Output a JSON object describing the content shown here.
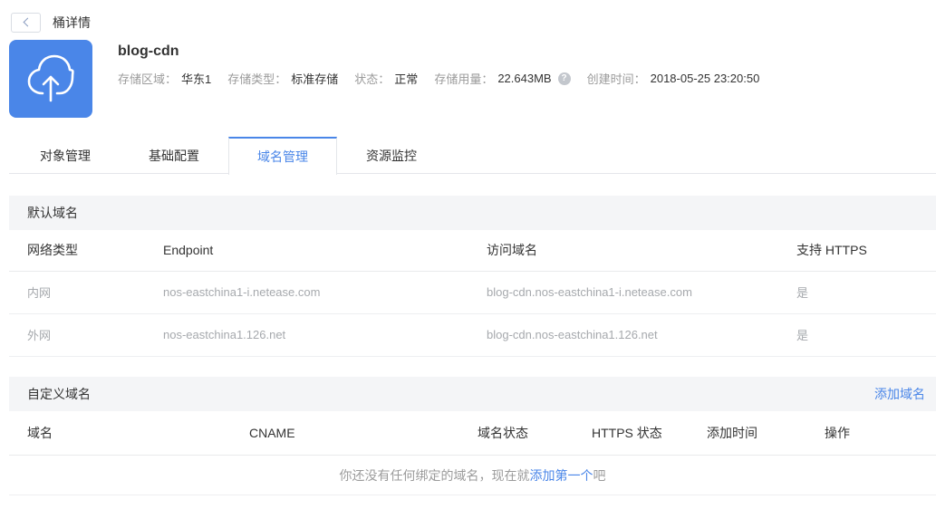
{
  "accent_color": "#4a86e8",
  "topbar": {
    "title": "桶详情"
  },
  "bucket": {
    "name": "blog-cdn",
    "icon": "cloud-upload-icon",
    "info": {
      "region_label": "存储区域：",
      "region_value": "华东1",
      "type_label": "存储类型：",
      "type_value": "标准存储",
      "status_label": "状态：",
      "status_value": "正常",
      "usage_label": "存储用量：",
      "usage_value": "22.643MB",
      "usage_help_icon": "?",
      "created_label": "创建时间：",
      "created_value": "2018-05-25 23:20:50"
    }
  },
  "tabs": [
    {
      "label": "对象管理",
      "active": false
    },
    {
      "label": "基础配置",
      "active": false
    },
    {
      "label": "域名管理",
      "active": true
    },
    {
      "label": "资源监控",
      "active": false
    }
  ],
  "default_domain": {
    "section_title": "默认域名",
    "columns": [
      "网络类型",
      "Endpoint",
      "访问域名",
      "支持 HTTPS"
    ],
    "rows": [
      [
        "内网",
        "nos-eastchina1-i.netease.com",
        "blog-cdn.nos-eastchina1-i.netease.com",
        "是"
      ],
      [
        "外网",
        "nos-eastchina1.126.net",
        "blog-cdn.nos-eastchina1.126.net",
        "是"
      ]
    ]
  },
  "custom_domain": {
    "section_title": "自定义域名",
    "add_link": "添加域名",
    "columns": [
      "域名",
      "CNAME",
      "域名状态",
      "HTTPS 状态",
      "添加时间",
      "操作"
    ],
    "empty_prefix": "你还没有任何绑定的域名，现在就",
    "empty_link": "添加第一个",
    "empty_suffix": "吧"
  }
}
